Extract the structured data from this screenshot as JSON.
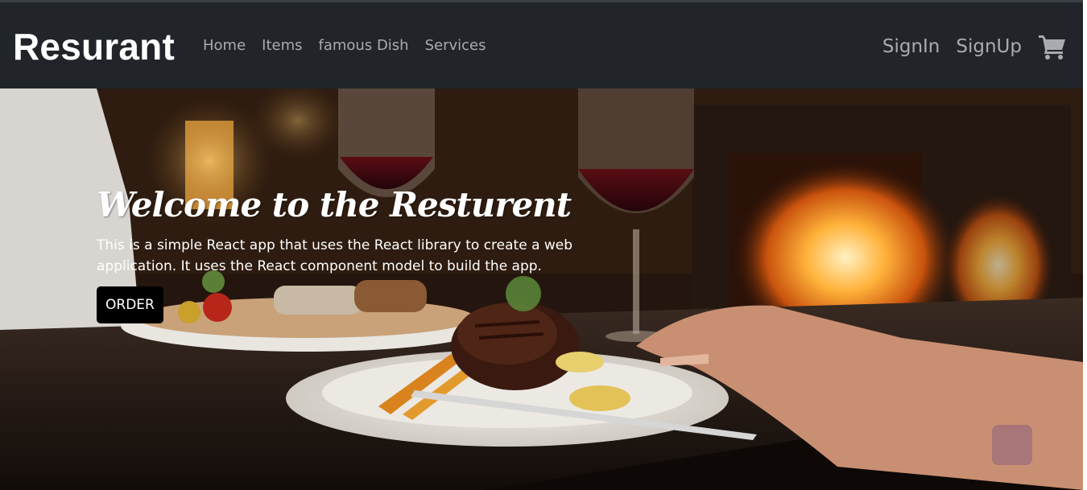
{
  "navbar": {
    "brand": "Resurant",
    "links": [
      "Home",
      "Items",
      "famous Dish",
      "Services"
    ],
    "signin": "SignIn",
    "signup": "SignUp",
    "cart_icon": "shopping-cart-icon"
  },
  "hero": {
    "title": "Welcome to the Resturent",
    "description": "This is a simple React app that uses the React library to create a web application. It uses the React component model to build the app.",
    "order_label": "ORDER",
    "background": "restaurant-dinner-photo"
  },
  "colors": {
    "navbar_bg": "#212529",
    "nav_link": "#a8abae",
    "brand": "#ffffff",
    "button_bg": "#000000"
  }
}
